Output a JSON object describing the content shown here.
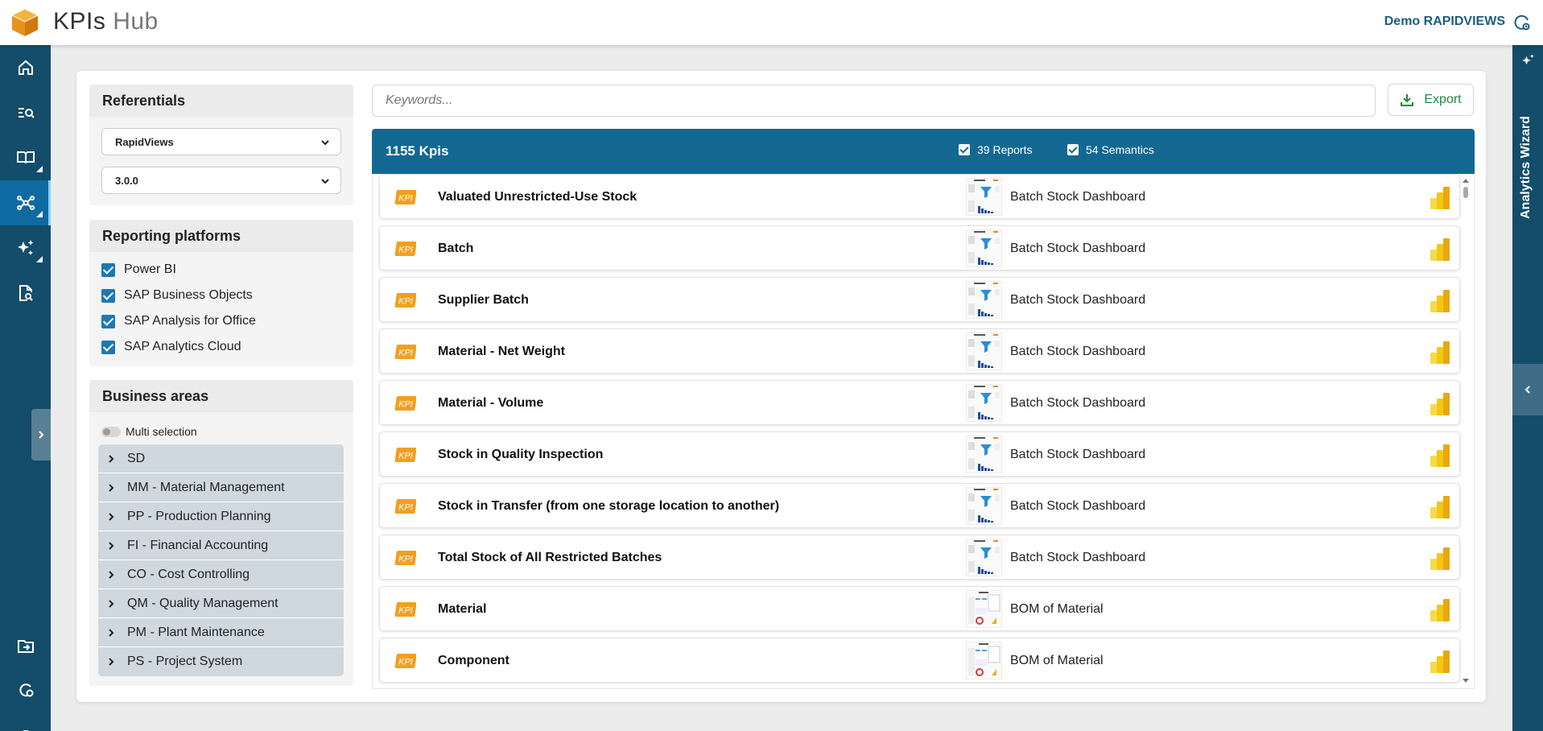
{
  "header": {
    "app_title_main": "KPIs",
    "app_title_sub": "Hub",
    "user_name": "Demo RAPIDVIEWS"
  },
  "sidebar": {
    "items": [
      {
        "icon": "home-icon"
      },
      {
        "icon": "search-list-icon"
      },
      {
        "icon": "book-icon"
      },
      {
        "icon": "network-icon",
        "active": true
      },
      {
        "icon": "sparkles-icon"
      },
      {
        "icon": "report-search-icon"
      },
      {
        "icon": "import-icon"
      },
      {
        "icon": "user-shield-icon"
      },
      {
        "icon": "gauge-icon"
      }
    ]
  },
  "right_panel": {
    "label": "Analytics Wizard"
  },
  "filters": {
    "referentials": {
      "title": "Referentials",
      "selected_source": "RapidViews",
      "selected_version": "3.0.0"
    },
    "reporting_platforms": {
      "title": "Reporting platforms",
      "options": [
        "Power BI",
        "SAP Business Objects",
        "SAP Analysis for Office",
        "SAP Analytics Cloud"
      ]
    },
    "business_areas": {
      "title": "Business areas",
      "multi_selection_label": "Multi selection",
      "items": [
        "SD",
        "MM - Material Management",
        "PP - Production Planning",
        "FI - Financial Accounting",
        "CO - Cost Controlling",
        "QM - Quality Management",
        "PM - Plant Maintenance",
        "PS - Project System"
      ]
    }
  },
  "search": {
    "placeholder": "Keywords..."
  },
  "toolbar": {
    "export_label": "Export"
  },
  "results": {
    "kpi_count": "1155 Kpis",
    "reports_label": "39 Reports",
    "semantics_label": "54 Semantics",
    "colors": {
      "header": "#136892",
      "kpi_badge": "#f0a020",
      "powerbi": "#f2c811"
    },
    "rows": [
      {
        "kpi": "Valuated Unrestricted-Use Stock",
        "report": "Batch Stock Dashboard",
        "thumb": "batch"
      },
      {
        "kpi": "Batch",
        "report": "Batch Stock Dashboard",
        "thumb": "batch"
      },
      {
        "kpi": "Supplier Batch",
        "report": "Batch Stock Dashboard",
        "thumb": "batch"
      },
      {
        "kpi": "Material - Net Weight",
        "report": "Batch Stock Dashboard",
        "thumb": "batch"
      },
      {
        "kpi": "Material - Volume",
        "report": "Batch Stock Dashboard",
        "thumb": "batch"
      },
      {
        "kpi": "Stock in Quality Inspection",
        "report": "Batch Stock Dashboard",
        "thumb": "batch"
      },
      {
        "kpi": "Stock in Transfer (from one storage location to another)",
        "report": "Batch Stock Dashboard",
        "thumb": "batch"
      },
      {
        "kpi": "Total Stock of All Restricted Batches",
        "report": "Batch Stock Dashboard",
        "thumb": "batch"
      },
      {
        "kpi": "Material",
        "report": "BOM of Material",
        "thumb": "bom"
      },
      {
        "kpi": "Component",
        "report": "BOM of Material",
        "thumb": "bom"
      }
    ]
  }
}
